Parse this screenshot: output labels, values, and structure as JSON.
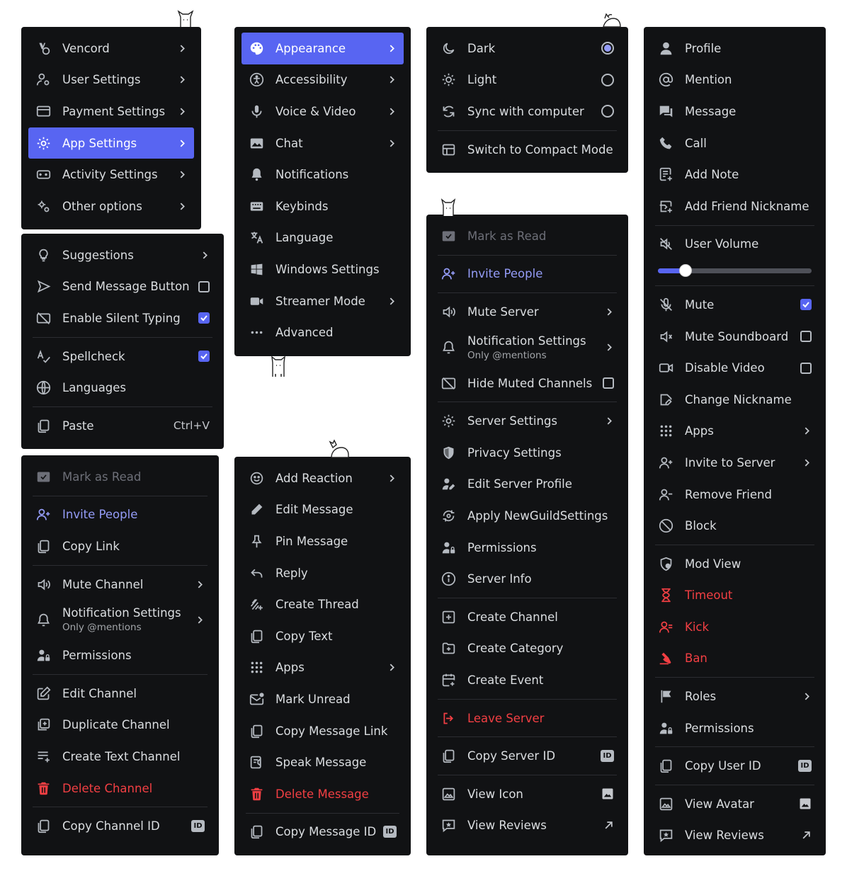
{
  "vencord_menu": {
    "items": [
      {
        "label": "Vencord"
      },
      {
        "label": "User Settings"
      },
      {
        "label": "Payment Settings"
      },
      {
        "label": "App Settings"
      },
      {
        "label": "Activity Settings"
      },
      {
        "label": "Other options"
      }
    ]
  },
  "app_settings_menu": {
    "items": [
      {
        "label": "Appearance"
      },
      {
        "label": "Accessibility"
      },
      {
        "label": "Voice & Video"
      },
      {
        "label": "Chat"
      },
      {
        "label": "Notifications"
      },
      {
        "label": "Keybinds"
      },
      {
        "label": "Language"
      },
      {
        "label": "Windows Settings"
      },
      {
        "label": "Streamer Mode"
      },
      {
        "label": "Advanced"
      }
    ]
  },
  "theme_menu": {
    "items": [
      {
        "label": "Dark",
        "selected": true
      },
      {
        "label": "Light",
        "selected": false
      },
      {
        "label": "Sync with computer",
        "selected": false
      },
      {
        "label": "Switch to Compact Mode"
      }
    ]
  },
  "input_menu": {
    "items": [
      {
        "label": "Suggestions"
      },
      {
        "label": "Send Message Button",
        "checked": false
      },
      {
        "label": "Enable Silent Typing",
        "checked": true
      },
      {
        "label": "Spellcheck",
        "checked": true
      },
      {
        "label": "Languages"
      },
      {
        "label": "Paste",
        "shortcut": "Ctrl+V"
      }
    ]
  },
  "channel_menu": {
    "items": [
      {
        "label": "Mark as Read"
      },
      {
        "label": "Invite People"
      },
      {
        "label": "Copy Link"
      },
      {
        "label": "Mute Channel"
      },
      {
        "label": "Notification Settings",
        "sub": "Only @mentions"
      },
      {
        "label": "Permissions"
      },
      {
        "label": "Edit Channel"
      },
      {
        "label": "Duplicate Channel"
      },
      {
        "label": "Create Text Channel"
      },
      {
        "label": "Delete Channel"
      },
      {
        "label": "Copy Channel ID",
        "badge": "ID"
      }
    ]
  },
  "message_menu": {
    "items": [
      {
        "label": "Add Reaction"
      },
      {
        "label": "Edit Message"
      },
      {
        "label": "Pin Message"
      },
      {
        "label": "Reply"
      },
      {
        "label": "Create Thread"
      },
      {
        "label": "Copy Text"
      },
      {
        "label": "Apps"
      },
      {
        "label": "Mark Unread"
      },
      {
        "label": "Copy Message Link"
      },
      {
        "label": "Speak Message"
      },
      {
        "label": "Delete Message"
      },
      {
        "label": "Copy Message ID",
        "badge": "ID"
      }
    ]
  },
  "server_menu": {
    "items": [
      {
        "label": "Mark as Read"
      },
      {
        "label": "Invite People"
      },
      {
        "label": "Mute Server"
      },
      {
        "label": "Notification Settings",
        "sub": "Only @mentions"
      },
      {
        "label": "Hide Muted Channels",
        "checked": false
      },
      {
        "label": "Server Settings"
      },
      {
        "label": "Privacy Settings"
      },
      {
        "label": "Edit Server Profile"
      },
      {
        "label": "Apply NewGuildSettings"
      },
      {
        "label": "Permissions"
      },
      {
        "label": "Server Info"
      },
      {
        "label": "Create Channel"
      },
      {
        "label": "Create Category"
      },
      {
        "label": "Create Event"
      },
      {
        "label": "Leave Server"
      },
      {
        "label": "Copy Server ID",
        "badge": "ID"
      },
      {
        "label": "View Icon"
      },
      {
        "label": "View Reviews"
      }
    ]
  },
  "user_menu": {
    "items": [
      {
        "label": "Profile"
      },
      {
        "label": "Mention"
      },
      {
        "label": "Message"
      },
      {
        "label": "Call"
      },
      {
        "label": "Add Note"
      },
      {
        "label": "Add Friend Nickname"
      },
      {
        "label": "User Volume",
        "volume": 0.18
      },
      {
        "label": "Mute",
        "checked": true
      },
      {
        "label": "Mute Soundboard",
        "checked": false
      },
      {
        "label": "Disable Video",
        "checked": false
      },
      {
        "label": "Change Nickname"
      },
      {
        "label": "Apps"
      },
      {
        "label": "Invite to Server"
      },
      {
        "label": "Remove Friend"
      },
      {
        "label": "Block"
      },
      {
        "label": "Mod View"
      },
      {
        "label": "Timeout"
      },
      {
        "label": "Kick"
      },
      {
        "label": "Ban"
      },
      {
        "label": "Roles"
      },
      {
        "label": "Permissions"
      },
      {
        "label": "Copy User ID",
        "badge": "ID"
      },
      {
        "label": "View Avatar"
      },
      {
        "label": "View Reviews"
      }
    ]
  },
  "colors": {
    "menu_bg": "#111214",
    "accent": "#5865f2",
    "accent_text": "#949cf7",
    "danger": "#f23f43",
    "text": "#dbdee1"
  }
}
